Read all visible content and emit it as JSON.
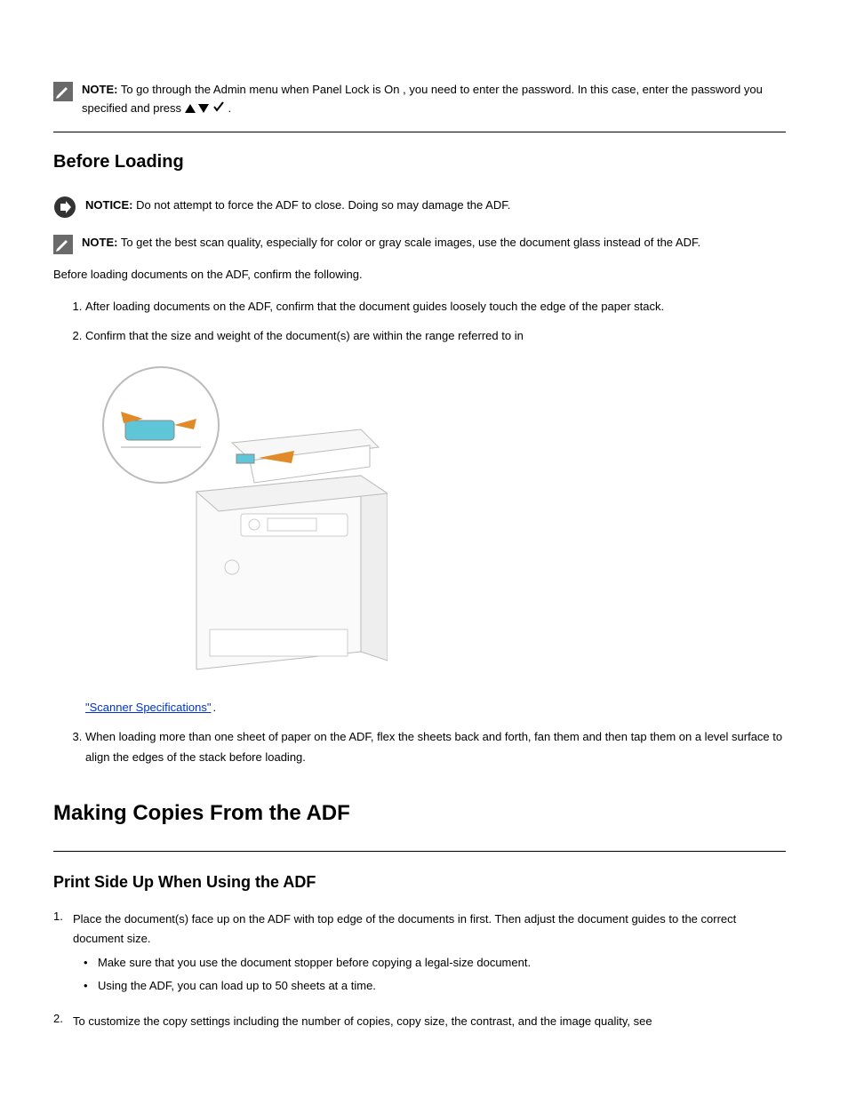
{
  "note1": {
    "label": "NOTE:",
    "text_a": " To go through the ",
    "code": "Admin",
    "text_b": " menu when ",
    "panel_lock": "Panel Lock",
    "text_c": " is ",
    "on": "On",
    "text_d": ", you need to enter the password. In this case, enter the password you specified and press   ."
  },
  "section_before_heading": "Before Loading",
  "notice": {
    "label": "NOTICE:",
    "text": " Do not attempt to force the ADF to close. Doing so may damage the ADF."
  },
  "note2": {
    "label": "NOTE:",
    "text": " To get the best scan quality, especially for color or gray scale images, use the document glass instead of the ADF."
  },
  "body_before": "Before loading documents on the ADF, confirm the following.",
  "steps1": [
    "After loading documents on the ADF, confirm that the document guides loosely touch the edge of the paper stack.",
    "Confirm that the size and weight of the document(s) are within the range referred to in "
  ],
  "link_text": "\"Scanner Specifications\"",
  "step1_after_link": ".",
  "step3": "When loading more than one sheet of paper on the ADF, flex the sheets back and forth, fan them and then tap them on a level surface to align the edges of the stack before loading.",
  "main_heading": "Making Copies From the ADF",
  "sub_heading": "Print Side Up When Using the ADF",
  "step_a_num": "1.",
  "step_a": "Place the document(s) face up on the ADF with top edge of the documents in first. Then adjust the document guides to the correct document size.",
  "bullets": [
    "Make sure that you use the document stopper before copying a legal-size document.",
    "Using the ADF, you can load up to 50 sheets at a time."
  ],
  "step_b_num": "2.",
  "step_b": "To customize the copy settings including the number of copies, copy size, the contrast, and the image quality, see "
}
